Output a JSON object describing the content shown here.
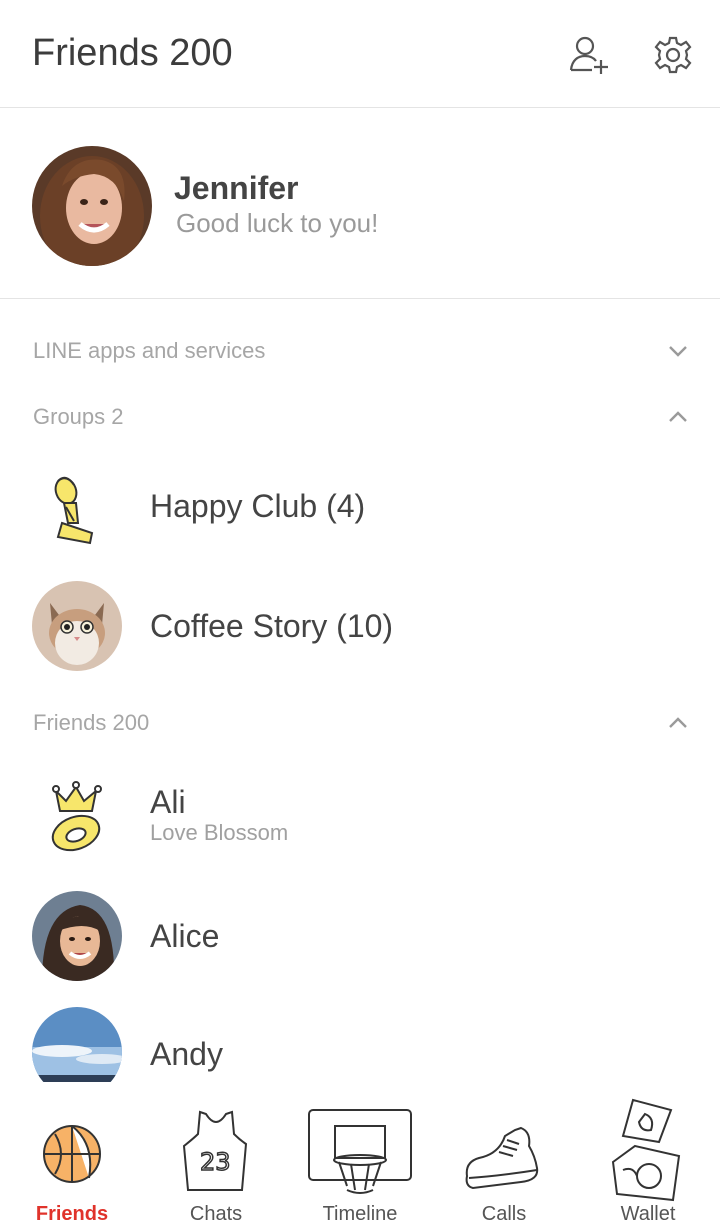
{
  "header": {
    "title": "Friends 200",
    "add_friend_icon": "add-friend-icon",
    "settings_icon": "gear-icon"
  },
  "profile": {
    "name": "Jennifer",
    "status": "Good luck to you!"
  },
  "sections": {
    "line_apps": {
      "label": "LINE apps and services",
      "state": "collapsed"
    },
    "groups": {
      "label": "Groups 2",
      "state": "expanded"
    },
    "friends": {
      "label": "Friends 200",
      "state": "expanded"
    }
  },
  "groups": [
    {
      "name": "Happy Club (4)",
      "icon": "trophy-icon"
    },
    {
      "name": "Coffee Story (10)",
      "icon": "cat-avatar"
    }
  ],
  "friends": [
    {
      "name": "Ali",
      "status": "Love Blossom",
      "icon": "crown-icon"
    },
    {
      "name": "Alice",
      "icon": "woman-avatar"
    },
    {
      "name": "Andy",
      "icon": "sky-avatar"
    }
  ],
  "tabs": [
    {
      "label": "Friends",
      "icon": "basketball-icon",
      "active": true
    },
    {
      "label": "Chats",
      "icon": "jersey-icon",
      "active": false
    },
    {
      "label": "Timeline",
      "icon": "hoop-icon",
      "active": false
    },
    {
      "label": "Calls",
      "icon": "sneaker-icon",
      "active": false
    },
    {
      "label": "Wallet",
      "icon": "court-icon",
      "active": false
    }
  ],
  "colors": {
    "accent": "#e0332b",
    "active_ball": "#f7b267",
    "trophy": "#f7e66b"
  }
}
